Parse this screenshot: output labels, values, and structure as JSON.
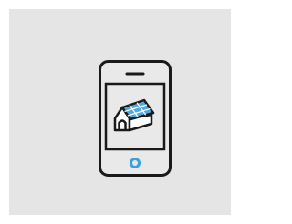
{
  "image": {
    "subject": "smartphone-solar-home-app-icon",
    "colors": {
      "background": "#e5e5e5",
      "outer_border": "#ffffff",
      "line": "#1a1a1a",
      "screen_fill": "#ffffff",
      "solar_panel": "#4fa8e0",
      "home_button": "#3aa0e0"
    },
    "icons": [
      "phone-icon",
      "house-icon",
      "solar-panel-icon",
      "home-button-icon",
      "speaker-slot-icon"
    ]
  }
}
